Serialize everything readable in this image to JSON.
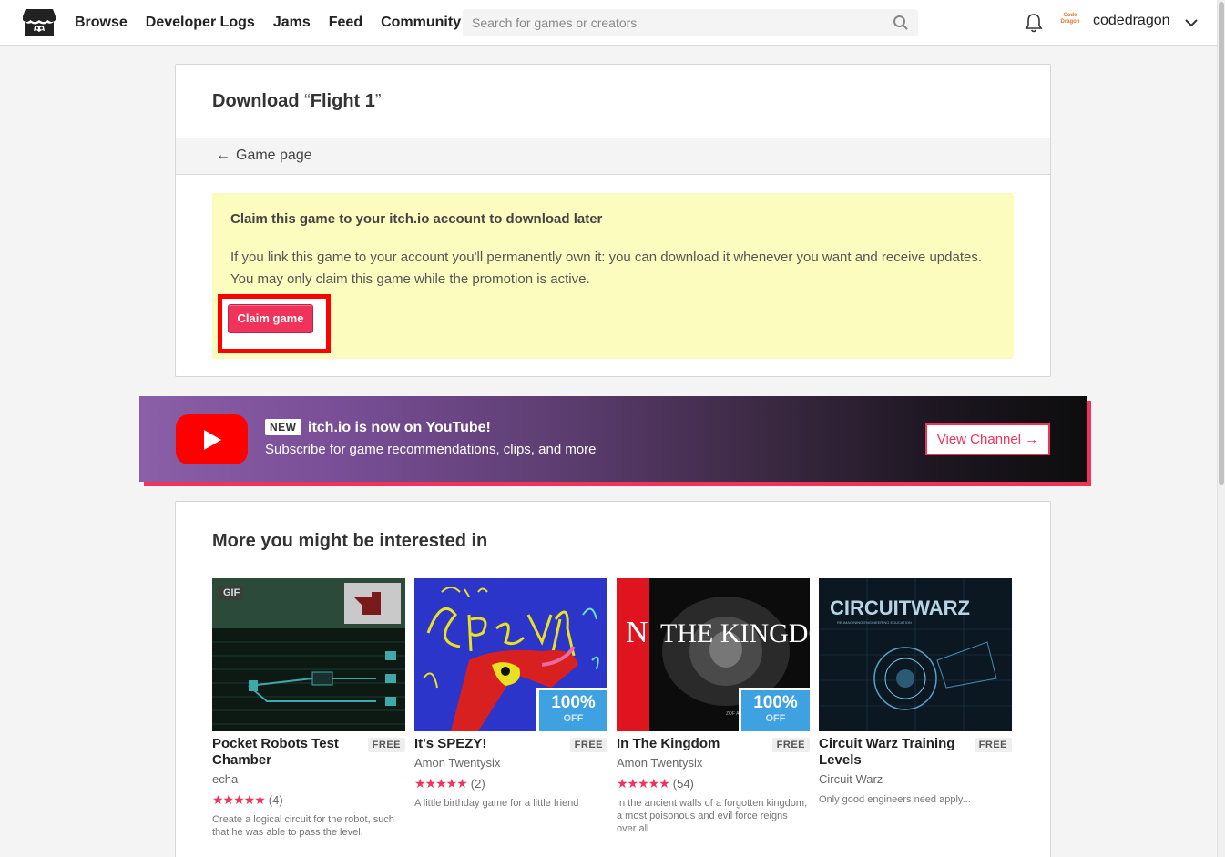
{
  "header": {
    "nav": [
      "Browse",
      "Developer Logs",
      "Jams",
      "Feed",
      "Community"
    ],
    "search_placeholder": "Search for games or creators",
    "avatar_text": "Code Dragon",
    "username": "codedragon"
  },
  "download": {
    "title_prefix": "Download",
    "open_quote": "“",
    "game_name": "Flight 1",
    "close_quote": "”",
    "back_link": "Game page",
    "claim_heading": "Claim this game to your itch.io account to download later",
    "claim_body": "If you link this game to your account you'll permanently own it: you can download it whenever you want and receive updates. You may only claim this game while the promotion is active.",
    "claim_button": "Claim game"
  },
  "youtube": {
    "badge": "NEW",
    "title": "itch.io is now on YouTube!",
    "subtitle": "Subscribe for game recommendations, clips, and more",
    "button": "View Channel →"
  },
  "recommendations": {
    "heading": "More you might be interested in",
    "games": [
      {
        "title": "Pocket Robots Test Chamber",
        "price": "FREE",
        "author": "echa",
        "stars": "★★★★★",
        "count": "(4)",
        "desc": "Create a logical circuit for the robot, such that he was able to pass the level.",
        "badge": "GIF"
      },
      {
        "title": "It's SPEZY!",
        "price": "FREE",
        "author": "Amon Twentysix",
        "stars": "★★★★★",
        "count": "(2)",
        "desc": "A little birthday game for a little friend",
        "discount": "100%",
        "discount_label": "OFF"
      },
      {
        "title": "In The Kingdom",
        "price": "FREE",
        "author": "Amon Twentysix",
        "stars": "★★★★★",
        "count": "(54)",
        "desc": "In the ancient walls of a forgotten kingdom, a most poisonous and evil force reigns over all",
        "discount": "100%",
        "discount_label": "OFF"
      },
      {
        "title": "Circuit Warz Training Levels",
        "price": "FREE",
        "author": "Circuit Warz",
        "desc": "Only good engineers need apply..."
      }
    ]
  },
  "colors": {
    "accent": "#f0335a",
    "promo_bg": "#fdfcbf",
    "highlight": "#ff0000",
    "discount": "#3da1e2"
  }
}
